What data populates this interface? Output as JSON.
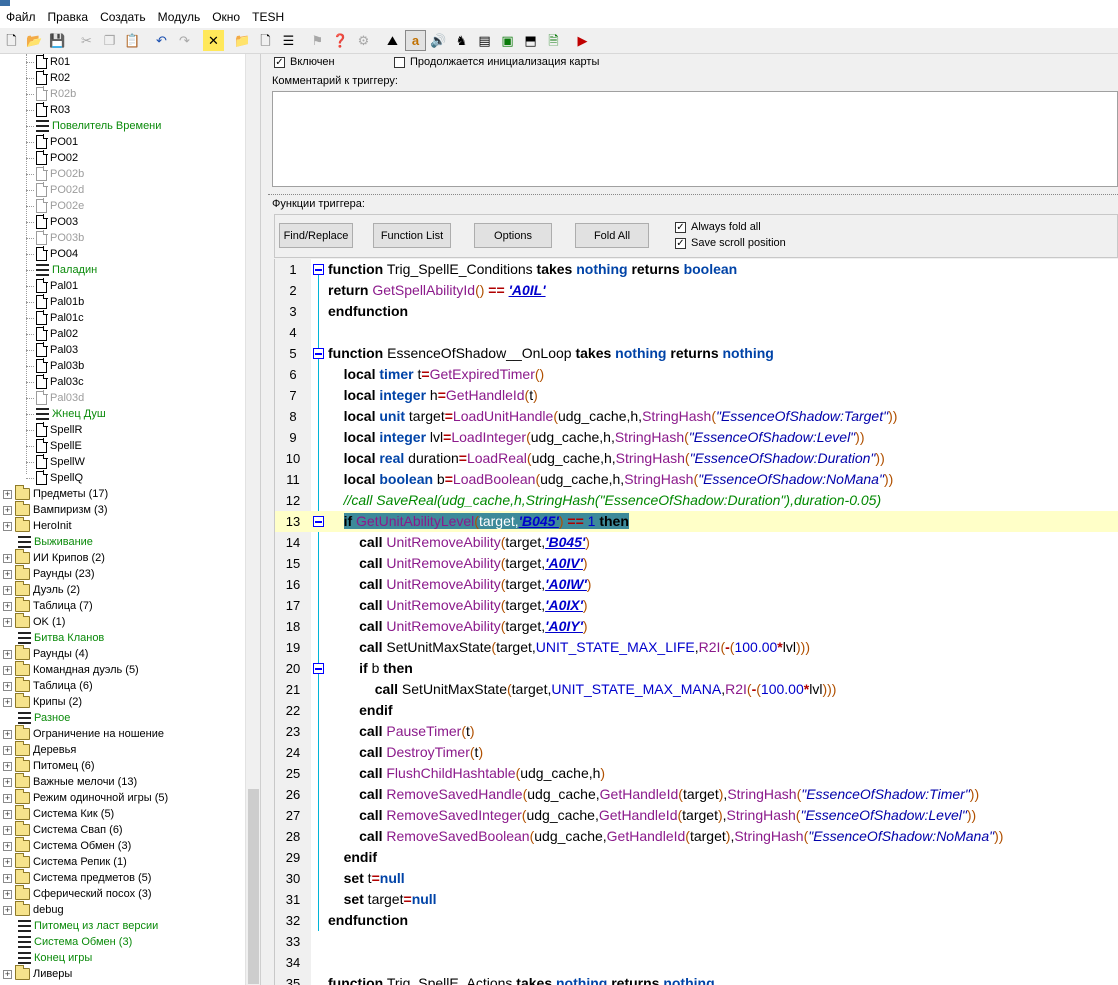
{
  "menu": [
    "Файл",
    "Правка",
    "Создать",
    "Модуль",
    "Окно",
    "TESH"
  ],
  "tree": {
    "triggers": [
      {
        "label": "R01",
        "icon": "doc",
        "state": "normal"
      },
      {
        "label": "R02",
        "icon": "doc",
        "state": "normal"
      },
      {
        "label": "R02b",
        "icon": "doc",
        "state": "disabled"
      },
      {
        "label": "R03",
        "icon": "doc",
        "state": "normal"
      },
      {
        "label": "Повелитель Времени",
        "icon": "comment",
        "state": "comment"
      },
      {
        "label": "PO01",
        "icon": "doc",
        "state": "normal"
      },
      {
        "label": "PO02",
        "icon": "doc",
        "state": "normal"
      },
      {
        "label": "PO02b",
        "icon": "doc",
        "state": "disabled"
      },
      {
        "label": "PO02d",
        "icon": "doc",
        "state": "disabled"
      },
      {
        "label": "PO02e",
        "icon": "doc",
        "state": "disabled"
      },
      {
        "label": "PO03",
        "icon": "doc",
        "state": "normal"
      },
      {
        "label": "PO03b",
        "icon": "doc",
        "state": "disabled"
      },
      {
        "label": "PO04",
        "icon": "doc",
        "state": "normal"
      },
      {
        "label": "Паладин",
        "icon": "comment",
        "state": "comment"
      },
      {
        "label": "Pal01",
        "icon": "doc",
        "state": "normal"
      },
      {
        "label": "Pal01b",
        "icon": "doc",
        "state": "normal"
      },
      {
        "label": "Pal01c",
        "icon": "doc",
        "state": "normal"
      },
      {
        "label": "Pal02",
        "icon": "doc",
        "state": "normal"
      },
      {
        "label": "Pal03",
        "icon": "doc",
        "state": "normal"
      },
      {
        "label": "Pal03b",
        "icon": "doc",
        "state": "normal"
      },
      {
        "label": "Pal03c",
        "icon": "doc",
        "state": "normal"
      },
      {
        "label": "Pal03d",
        "icon": "doc",
        "state": "disabled"
      },
      {
        "label": "Жнец Душ",
        "icon": "comment",
        "state": "comment"
      },
      {
        "label": "SpellR",
        "icon": "doc",
        "state": "normal"
      },
      {
        "label": "SpellE",
        "icon": "doc",
        "state": "normal"
      },
      {
        "label": "SpellW",
        "icon": "doc",
        "state": "normal"
      },
      {
        "label": "SpellQ",
        "icon": "doc",
        "state": "normal"
      }
    ],
    "folders": [
      {
        "label": "Предметы (17)",
        "icon": "folder"
      },
      {
        "label": "Вампиризм (3)",
        "icon": "folder"
      },
      {
        "label": "HeroInit",
        "icon": "folder"
      },
      {
        "label": "Выживание",
        "icon": "comment"
      },
      {
        "label": "ИИ Крипов (2)",
        "icon": "folder"
      },
      {
        "label": "Раунды (23)",
        "icon": "folder"
      },
      {
        "label": "Дуэль (2)",
        "icon": "folder"
      },
      {
        "label": "Таблица (7)",
        "icon": "folder"
      },
      {
        "label": "OK (1)",
        "icon": "folder"
      },
      {
        "label": "Битва Кланов",
        "icon": "comment"
      },
      {
        "label": "Раунды (4)",
        "icon": "folder"
      },
      {
        "label": "Командная дуэль (5)",
        "icon": "folder"
      },
      {
        "label": "Таблица (6)",
        "icon": "folder"
      },
      {
        "label": "Крипы (2)",
        "icon": "folder"
      },
      {
        "label": "Разное",
        "icon": "comment"
      },
      {
        "label": "Ограничение на ношение",
        "icon": "folder"
      },
      {
        "label": "Деревья",
        "icon": "folder"
      },
      {
        "label": "Питомец (6)",
        "icon": "folder"
      },
      {
        "label": "Важные мелочи (13)",
        "icon": "folder"
      },
      {
        "label": "Режим одиночной игры (5)",
        "icon": "folder"
      },
      {
        "label": "Система Кик (5)",
        "icon": "folder"
      },
      {
        "label": "Система Свап (6)",
        "icon": "folder"
      },
      {
        "label": "Система Обмен (3)",
        "icon": "folder"
      },
      {
        "label": "Система Репик (1)",
        "icon": "folder"
      },
      {
        "label": "Система предметов (5)",
        "icon": "folder"
      },
      {
        "label": "Сферический посох (3)",
        "icon": "folder"
      },
      {
        "label": "debug",
        "icon": "folder"
      },
      {
        "label": "Питомец из ласт версии",
        "icon": "comment"
      },
      {
        "label": "Система Обмен (3)",
        "icon": "comment"
      },
      {
        "label": "Конец игры",
        "icon": "comment"
      },
      {
        "label": "Ливеры",
        "icon": "folder"
      }
    ]
  },
  "trigger_panel": {
    "enabled_label": "Включен",
    "enabled_checked": true,
    "continue_label": "Продолжается инициализация карты",
    "continue_checked": false,
    "comment_label": "Комментарий к триггеру:",
    "functions_label": "Функции триггера:"
  },
  "editor_toolbar": {
    "find_replace": "Find/Replace",
    "function_list": "Function List",
    "options": "Options",
    "fold_all": "Fold All",
    "always_fold_label": "Always fold all",
    "always_fold_checked": true,
    "save_scroll_label": "Save scroll position",
    "save_scroll_checked": true
  },
  "code": {
    "highlighted_line": 13,
    "lines": [
      "function Trig_SpellE_Conditions takes nothing returns boolean",
      "return GetSpellAbilityId() == 'A0IL'",
      "endfunction",
      "",
      "function EssenceOfShadow__OnLoop takes nothing returns nothing",
      "    local timer t=GetExpiredTimer()",
      "    local integer h=GetHandleId(t)",
      "    local unit target=LoadUnitHandle(udg_cache,h,StringHash(\"EssenceOfShadow:Target\"))",
      "    local integer lvl=LoadInteger(udg_cache,h,StringHash(\"EssenceOfShadow:Level\"))",
      "    local real duration=LoadReal(udg_cache,h,StringHash(\"EssenceOfShadow:Duration\"))",
      "    local boolean b=LoadBoolean(udg_cache,h,StringHash(\"EssenceOfShadow:NoMana\"))",
      "    //call SaveReal(udg_cache,h,StringHash(\"EssenceOfShadow:Duration\"),duration-0.05)",
      "    if GetUnitAbilityLevel(target,'B045') == 1 then",
      "        call UnitRemoveAbility(target,'B045')",
      "        call UnitRemoveAbility(target,'A0IV')",
      "        call UnitRemoveAbility(target,'A0IW')",
      "        call UnitRemoveAbility(target,'A0IX')",
      "        call UnitRemoveAbility(target,'A0IY')",
      "        call SetUnitMaxState(target,UNIT_STATE_MAX_LIFE,R2I(-(100.00*lvl)))",
      "        if b then",
      "            call SetUnitMaxState(target,UNIT_STATE_MAX_MANA,R2I(-(100.00*lvl)))",
      "        endif",
      "        call PauseTimer(t)",
      "        call DestroyTimer(t)",
      "        call FlushChildHashtable(udg_cache,h)",
      "        call RemoveSavedHandle(udg_cache,GetHandleId(target),StringHash(\"EssenceOfShadow:Timer\"))",
      "        call RemoveSavedInteger(udg_cache,GetHandleId(target),StringHash(\"EssenceOfShadow:Level\"))",
      "        call RemoveSavedBoolean(udg_cache,GetHandleId(target),StringHash(\"EssenceOfShadow:NoMana\"))",
      "    endif",
      "    set t=null",
      "    set target=null",
      "endfunction",
      "",
      "",
      "function Trig_SpellE_Actions takes nothing returns nothing"
    ],
    "fold_markers": [
      1,
      5,
      13,
      20
    ]
  }
}
